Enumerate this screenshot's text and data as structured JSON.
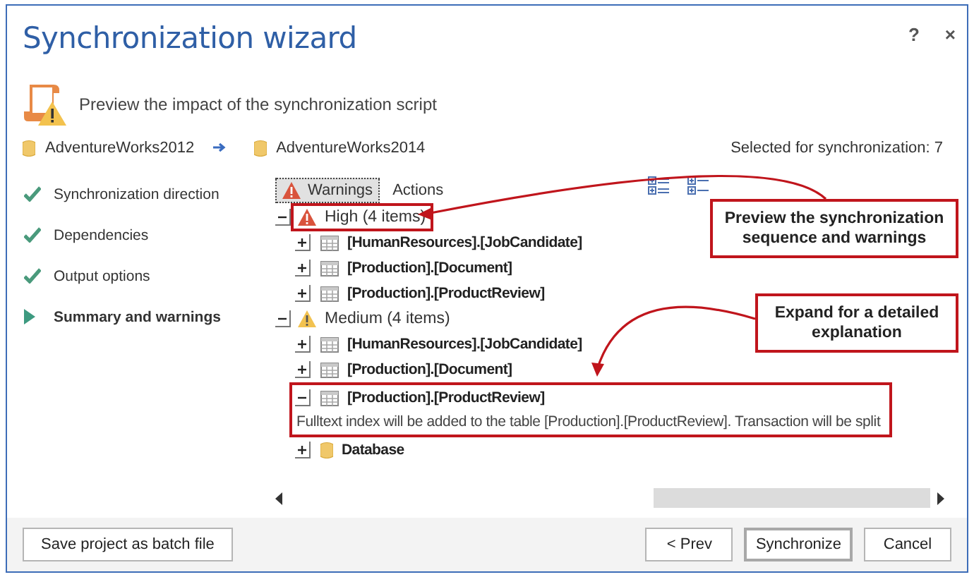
{
  "window": {
    "title": "Synchronization wizard",
    "buttons": [
      {
        "label": "?"
      },
      {
        "label": "×"
      }
    ]
  },
  "header": {
    "text": "Preview the impact of the synchronization script"
  },
  "databases": {
    "source": "AdventureWorks2012",
    "target": "AdventureWorks2014",
    "selected_count": "Selected for synchronization: 7"
  },
  "steps": [
    {
      "label": "Synchronization direction",
      "done": true,
      "selected": false
    },
    {
      "label": "Dependencies",
      "done": true,
      "selected": false
    },
    {
      "label": "Output options",
      "done": true,
      "selected": false
    },
    {
      "label": "Summary and warnings",
      "done": false,
      "selected": true
    }
  ],
  "tabs": [
    {
      "label": "Warnings",
      "selected": true,
      "kind": "warnings"
    },
    {
      "label": "Actions",
      "selected": false,
      "kind": "actions"
    }
  ],
  "tree": [
    {
      "label": "High (4 items)",
      "kind": "high",
      "expanded": true,
      "highlighted": true,
      "children": [
        {
          "label": "[HumanResources].[JobCandidate]",
          "kind": "table",
          "expanded": false,
          "highlighted": false
        },
        {
          "label": "[Production].[Document]",
          "kind": "table",
          "expanded": false,
          "highlighted": false
        },
        {
          "label": "[Production].[ProductReview]",
          "kind": "table",
          "expanded": false,
          "highlighted": false
        }
      ]
    },
    {
      "label": "Medium (4 items)",
      "kind": "medium",
      "expanded": true,
      "highlighted": false,
      "children": [
        {
          "label": "[HumanResources].[JobCandidate]",
          "kind": "table",
          "expanded": false,
          "highlighted": false
        },
        {
          "label": "[Production].[Document]",
          "kind": "table",
          "expanded": false,
          "highlighted": false
        },
        {
          "label": "[Production].[ProductReview]",
          "kind": "table",
          "expanded": true,
          "highlighted": true,
          "children": [
            {
              "label": "Fulltext index will be added to the table [Production].[ProductReview]. Transaction will be split",
              "kind": "message"
            }
          ]
        },
        {
          "label": "Database",
          "kind": "database",
          "expanded": false,
          "highlighted": false
        }
      ]
    }
  ],
  "callouts": [
    {
      "text": "Preview the synchronization sequence and warnings"
    },
    {
      "text": "Expand for a detailed explanation"
    }
  ],
  "footer": {
    "left_buttons": [
      {
        "label": "Save project as batch file",
        "default": false
      }
    ],
    "right_buttons": [
      {
        "label": "< Prev",
        "default": false
      },
      {
        "label": "Synchronize",
        "default": true
      },
      {
        "label": "Cancel",
        "default": false
      }
    ]
  }
}
